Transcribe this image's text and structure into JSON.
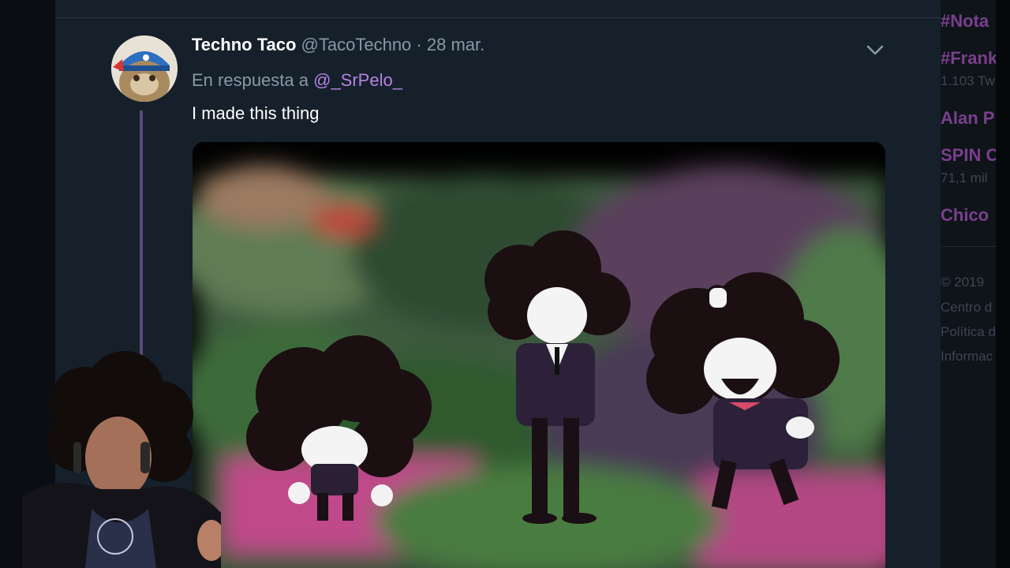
{
  "tweet": {
    "display_name": "Techno Taco",
    "handle": "@TacoTechno",
    "separator": "·",
    "date": "28 mar.",
    "reply_prefix": "En respuesta a",
    "reply_to": "@_SrPelo_",
    "text": "I made this thing"
  },
  "sidebar": {
    "trends": [
      {
        "label": "#Nota",
        "count": ""
      },
      {
        "label": "#Frank",
        "count": "1.103 Tw"
      },
      {
        "label": "Alan P",
        "count": ""
      },
      {
        "label": "SPIN C",
        "count": "71,1 mil"
      },
      {
        "label": "Chico",
        "count": ""
      }
    ],
    "footer": [
      "© 2019",
      "Centro d",
      "Política d",
      "Informac"
    ]
  },
  "icons": {
    "caret": "chevron-down-icon",
    "avatar": "cat-avatar"
  },
  "colors": {
    "background": "#15202b",
    "mention": "#b583e0",
    "thread_line": "#5b4a78",
    "trend": "#7a3f8e"
  }
}
